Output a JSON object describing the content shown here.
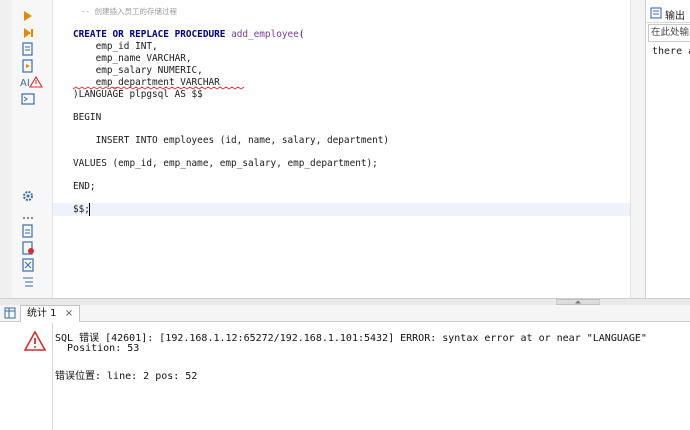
{
  "editor": {
    "comment": "-- 创建插入员工的存储过程",
    "lines": {
      "l1_kw": "CREATE OR REPLACE PROCEDURE",
      "l1_fn": "add_employee",
      "l1_tail": "(",
      "l2": "    emp_id INT,",
      "l3": "    emp_name VARCHAR,",
      "l4": "    emp_salary NUMERIC,",
      "l5": "    emp_department VARCHAR",
      "l6": ")LANGUAGE plpgsql AS $$",
      "l7": "BEGIN",
      "l8": "    INSERT INTO employees (id, name, salary, department)",
      "l9": "VALUES (emp_id, emp_name, emp_salary, emp_department);",
      "l10": "END;",
      "l11": "$$;"
    }
  },
  "output_panel": {
    "tab_label": "输出",
    "input_placeholder": "在此处输入",
    "text": "there a"
  },
  "bottom": {
    "tab_label": "统计 1",
    "error_line1": "SQL 错误 [42601]: [192.168.1.12:65272/192.168.1.101:5432] ERROR: syntax error at or near \"LANGUAGE\"",
    "error_line2": "  Position: 53",
    "error_line3": "错误位置: line: 2 pos: 52"
  },
  "colors": {
    "run_icon": "#e08a00",
    "warning": "#d32f2f",
    "keyword": "#000080",
    "function": "#7a3a9a"
  }
}
